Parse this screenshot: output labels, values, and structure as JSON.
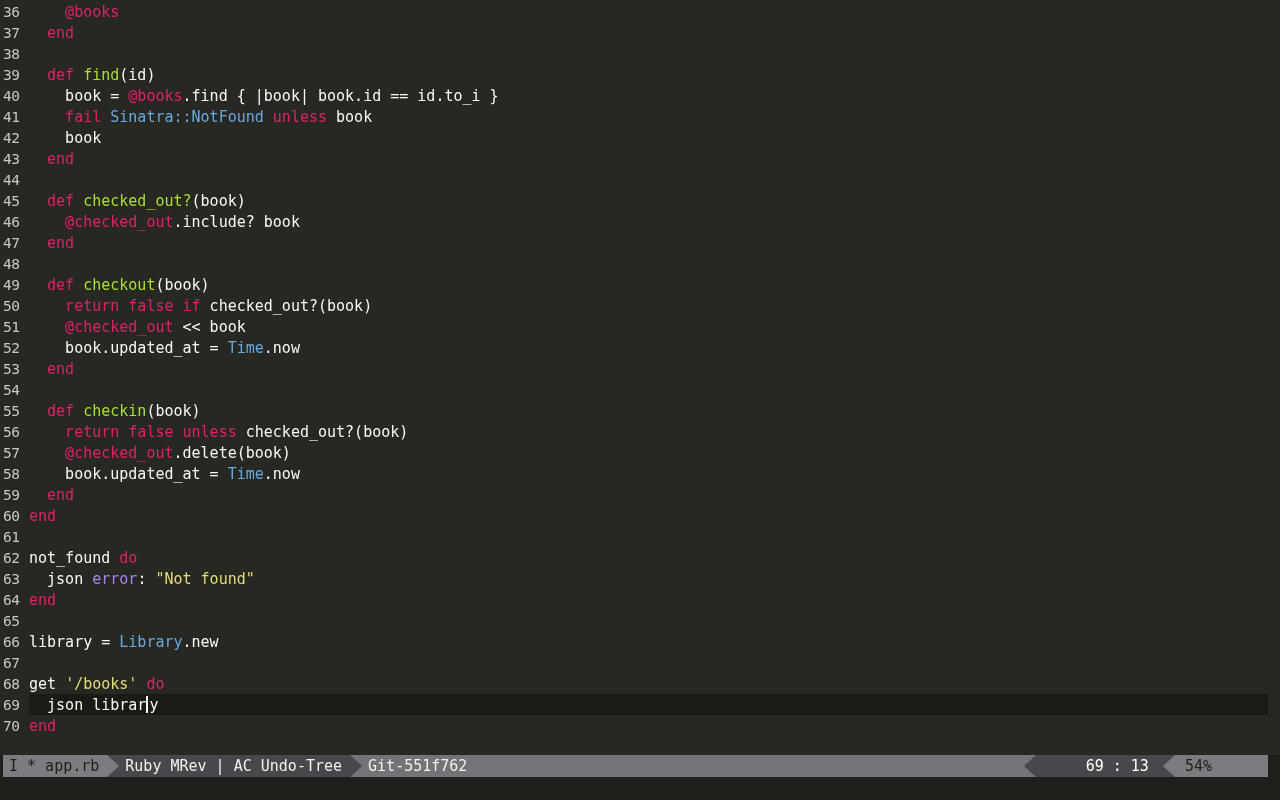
{
  "lines": [
    {
      "number": "36",
      "current": false,
      "tokens": [
        {
          "kind": "ivar",
          "text": "    @books"
        }
      ]
    },
    {
      "number": "37",
      "current": false,
      "tokens": [
        {
          "kind": "keyword",
          "text": "  end"
        }
      ]
    },
    {
      "number": "38",
      "current": false
    },
    {
      "number": "39",
      "current": false,
      "tokens": [
        {
          "kind": "keyword",
          "text": "  def "
        },
        {
          "kind": "function",
          "text": "find"
        },
        {
          "kind": "plain",
          "text": "(id)"
        }
      ]
    },
    {
      "number": "40",
      "current": false,
      "tokens": [
        {
          "kind": "plain",
          "text": "    book = "
        },
        {
          "kind": "ivar",
          "text": "@books"
        },
        {
          "kind": "plain",
          "text": ".find { |book| book.id == id.to_i }"
        }
      ]
    },
    {
      "number": "41",
      "current": false,
      "tokens": [
        {
          "kind": "keyword",
          "text": "    fail "
        },
        {
          "kind": "constant",
          "text": "Sinatra::NotFound "
        },
        {
          "kind": "keyword",
          "text": "unless"
        },
        {
          "kind": "plain",
          "text": " book"
        }
      ]
    },
    {
      "number": "42",
      "current": false,
      "tokens": [
        {
          "kind": "plain",
          "text": "    book"
        }
      ]
    },
    {
      "number": "43",
      "current": false,
      "tokens": [
        {
          "kind": "keyword",
          "text": "  end"
        }
      ]
    },
    {
      "number": "44",
      "current": false
    },
    {
      "number": "45",
      "current": false,
      "tokens": [
        {
          "kind": "keyword",
          "text": "  def "
        },
        {
          "kind": "function",
          "text": "checked_out?"
        },
        {
          "kind": "plain",
          "text": "(book)"
        }
      ]
    },
    {
      "number": "46",
      "current": false,
      "tokens": [
        {
          "kind": "ivar",
          "text": "    @checked_out"
        },
        {
          "kind": "plain",
          "text": ".include? book"
        }
      ]
    },
    {
      "number": "47",
      "current": false,
      "tokens": [
        {
          "kind": "keyword",
          "text": "  end"
        }
      ]
    },
    {
      "number": "48",
      "current": false
    },
    {
      "number": "49",
      "current": false,
      "tokens": [
        {
          "kind": "keyword",
          "text": "  def "
        },
        {
          "kind": "function",
          "text": "checkout"
        },
        {
          "kind": "plain",
          "text": "(book)"
        }
      ]
    },
    {
      "number": "50",
      "current": false,
      "tokens": [
        {
          "kind": "keyword",
          "text": "    return false if"
        },
        {
          "kind": "plain",
          "text": " checked_out?(book)"
        }
      ]
    },
    {
      "number": "51",
      "current": false,
      "tokens": [
        {
          "kind": "ivar",
          "text": "    @checked_out"
        },
        {
          "kind": "plain",
          "text": " << book"
        }
      ]
    },
    {
      "number": "52",
      "current": false,
      "tokens": [
        {
          "kind": "plain",
          "text": "    book.updated_at = "
        },
        {
          "kind": "constant",
          "text": "Time"
        },
        {
          "kind": "plain",
          "text": ".now"
        }
      ]
    },
    {
      "number": "53",
      "current": false,
      "tokens": [
        {
          "kind": "keyword",
          "text": "  end"
        }
      ]
    },
    {
      "number": "54",
      "current": false
    },
    {
      "number": "55",
      "current": false,
      "tokens": [
        {
          "kind": "keyword",
          "text": "  def "
        },
        {
          "kind": "function",
          "text": "checkin"
        },
        {
          "kind": "plain",
          "text": "(book)"
        }
      ]
    },
    {
      "number": "56",
      "current": false,
      "tokens": [
        {
          "kind": "keyword",
          "text": "    return false unless"
        },
        {
          "kind": "plain",
          "text": " checked_out?(book)"
        }
      ]
    },
    {
      "number": "57",
      "current": false,
      "tokens": [
        {
          "kind": "ivar",
          "text": "    @checked_out"
        },
        {
          "kind": "plain",
          "text": ".delete(book)"
        }
      ]
    },
    {
      "number": "58",
      "current": false,
      "tokens": [
        {
          "kind": "plain",
          "text": "    book.updated_at = "
        },
        {
          "kind": "constant",
          "text": "Time"
        },
        {
          "kind": "plain",
          "text": ".now"
        }
      ]
    },
    {
      "number": "59",
      "current": false,
      "tokens": [
        {
          "kind": "keyword",
          "text": "  end"
        }
      ]
    },
    {
      "number": "60",
      "current": false,
      "tokens": [
        {
          "kind": "keyword",
          "text": "end"
        }
      ]
    },
    {
      "number": "61",
      "current": false
    },
    {
      "number": "62",
      "current": false,
      "tokens": [
        {
          "kind": "plain",
          "text": "not_found "
        },
        {
          "kind": "keyword",
          "text": "do"
        }
      ]
    },
    {
      "number": "63",
      "current": false,
      "tokens": [
        {
          "kind": "plain",
          "text": "  json "
        },
        {
          "kind": "symbol",
          "text": "error"
        },
        {
          "kind": "plain",
          "text": ": "
        },
        {
          "kind": "string",
          "text": "\"Not found\""
        }
      ]
    },
    {
      "number": "64",
      "current": false,
      "tokens": [
        {
          "kind": "keyword",
          "text": "end"
        }
      ]
    },
    {
      "number": "65",
      "current": false
    },
    {
      "number": "66",
      "current": false,
      "tokens": [
        {
          "kind": "plain",
          "text": "library = "
        },
        {
          "kind": "constant",
          "text": "Library"
        },
        {
          "kind": "plain",
          "text": ".new"
        }
      ]
    },
    {
      "number": "67",
      "current": false
    },
    {
      "number": "68",
      "current": false,
      "tokens": [
        {
          "kind": "plain",
          "text": "get "
        },
        {
          "kind": "string",
          "text": "'/books'"
        },
        {
          "kind": "keyword",
          "text": " do"
        }
      ]
    },
    {
      "number": "69",
      "current": true,
      "tokens": [
        {
          "kind": "plain",
          "text": "  json librar"
        },
        {
          "kind": "plain",
          "text": "y",
          "cursor": true
        }
      ]
    },
    {
      "number": "70",
      "current": false,
      "tokens": [
        {
          "kind": "keyword",
          "text": "end"
        }
      ]
    }
  ],
  "status_bar": {
    "mode_file": "I * app.rb",
    "language_modes": "Ruby MRev | AC Undo-Tree",
    "git": "Git-551f762",
    "position": "69 : 13",
    "percent": "54%"
  }
}
